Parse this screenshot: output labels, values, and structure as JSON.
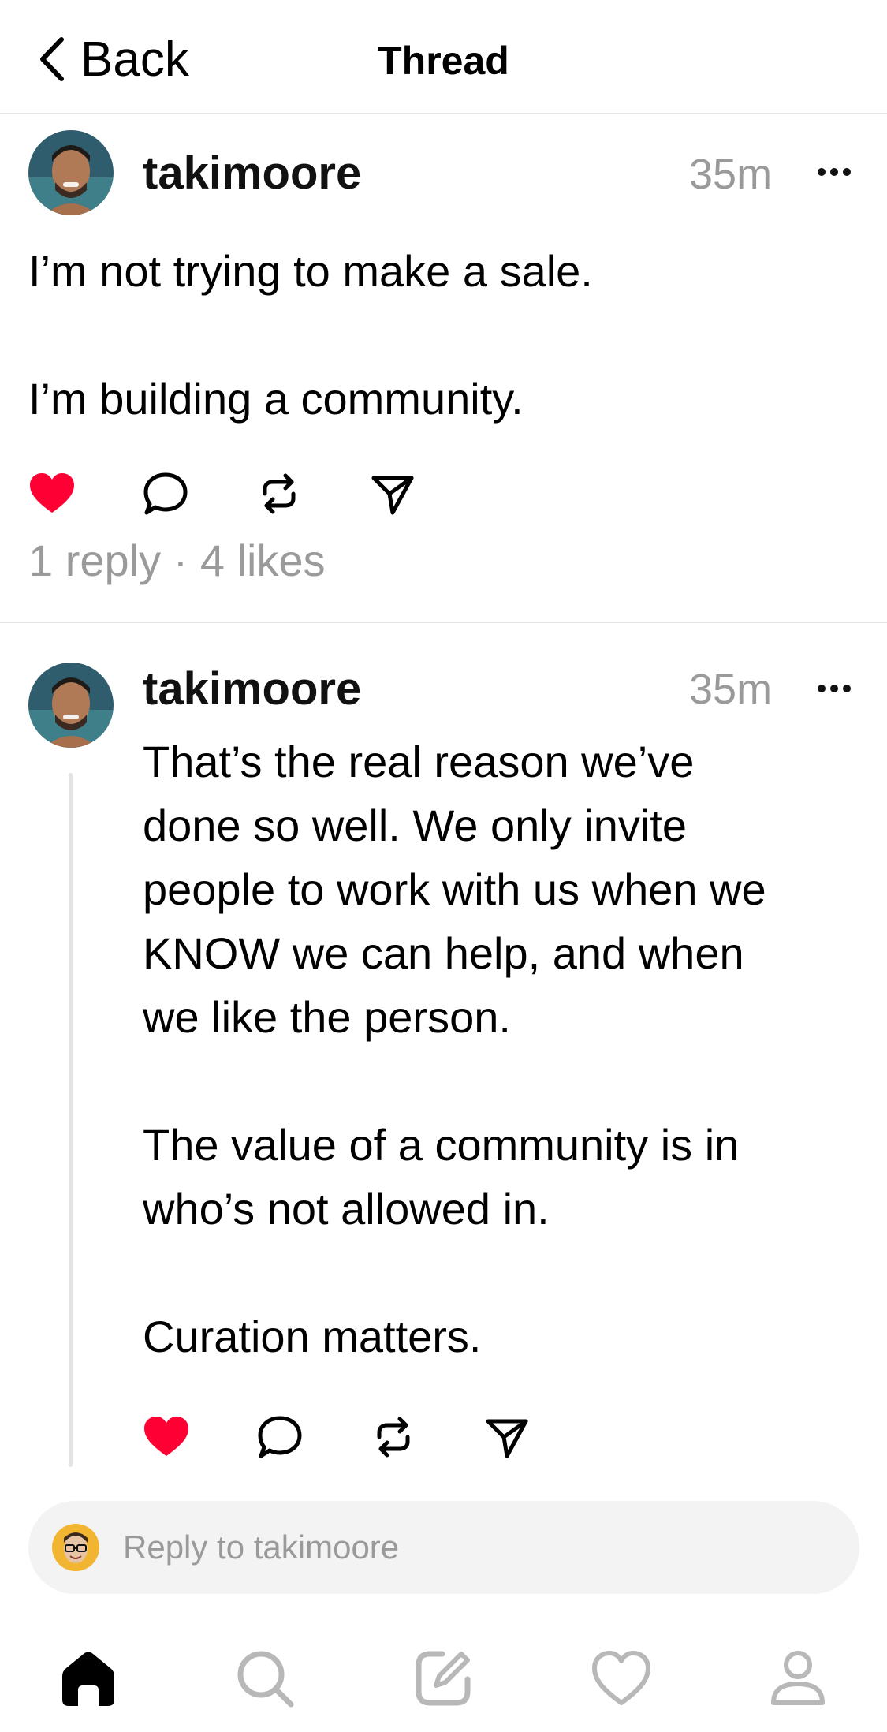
{
  "header": {
    "back_label": "Back",
    "title": "Thread"
  },
  "post": {
    "username": "takimoore",
    "time": "35m",
    "text": "I’m not trying to make a sale.\n\nI’m building a community.",
    "liked": true,
    "stats": "1 reply · 4 likes"
  },
  "reply": {
    "username": "takimoore",
    "time": "35m",
    "text": "That’s the real reason we’ve\ndone so well. We only invite\npeople to work with us when we\nKNOW we can help, and when\nwe like the person.\n\nThe value of a community is in\nwho’s not allowed in.\n\nCuration matters.",
    "liked": true
  },
  "reply_bar": {
    "placeholder": "Reply to takimoore"
  },
  "tabs": [
    {
      "icon": "home-icon",
      "active": true
    },
    {
      "icon": "search-icon",
      "active": false
    },
    {
      "icon": "compose-icon",
      "active": false
    },
    {
      "icon": "heart-icon",
      "active": false
    },
    {
      "icon": "profile-icon",
      "active": false
    }
  ],
  "colors": {
    "like": "#ff0034",
    "muted": "#9a9a9a",
    "divider": "#e6e6e6"
  }
}
